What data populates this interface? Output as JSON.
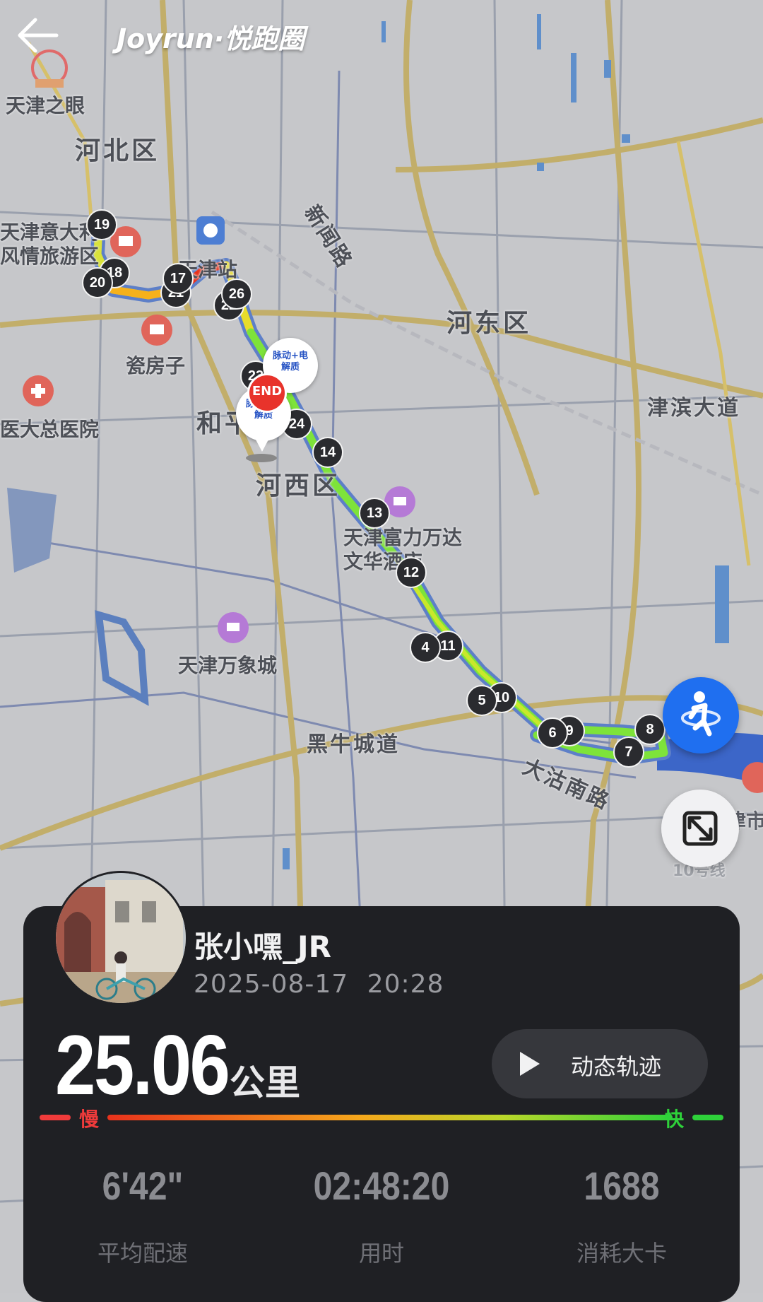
{
  "app": {
    "brand": "Joyrun·悦跑圈"
  },
  "map": {
    "districts": [
      "河北区",
      "河东区",
      "和平",
      "河西区"
    ],
    "streets": [
      "新闻路",
      "津滨大道",
      "黑牛城道",
      "大沽南路"
    ],
    "pois": [
      "天津之眼",
      "天津意大利风情旅游区",
      "瓷房子",
      "医大总医院",
      "天津站",
      "天津富力万达文华酒店",
      "天津万象城",
      "10号线",
      "天津市"
    ],
    "markers": [
      "19",
      "18",
      "20",
      "21",
      "17",
      "22",
      "26",
      "23",
      "24",
      "14",
      "13",
      "12",
      "11",
      "4",
      "10",
      "5",
      "9",
      "6",
      "8",
      "7"
    ],
    "end_label": "END",
    "sponsor_label": "脉动+电解质"
  },
  "user": {
    "name": "张小嘿_JR",
    "datetime": "2025-08-17  20:28"
  },
  "run": {
    "distance": "25.06",
    "unit": "公里",
    "replay_label": "动态轨迹",
    "slow_label": "慢",
    "fast_label": "快"
  },
  "stats": [
    {
      "value": "6'42\"",
      "label": "平均配速"
    },
    {
      "value": "02:48:20",
      "label": "用时"
    },
    {
      "value": "1688",
      "label": "消耗大卡"
    }
  ],
  "colors": {
    "track_fast": "#7ee33a",
    "track_slow": "#e8321c",
    "accent": "#1f6ff0",
    "card_bg": "#1f2024"
  },
  "icons": {
    "back": "back-arrow-icon",
    "runner": "runner-icon",
    "expand": "expand-icon",
    "play": "play-icon"
  }
}
